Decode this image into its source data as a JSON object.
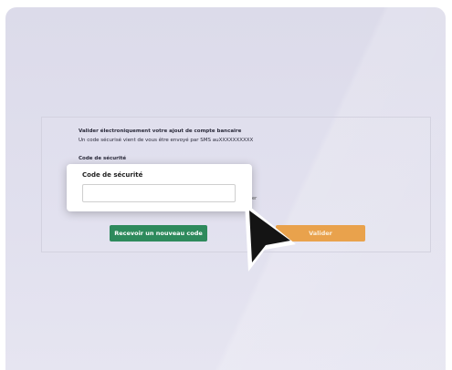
{
  "form": {
    "title": "Valider électroniquement votre ajout de compte bancaire",
    "subtitle": "Un code sécurisé vient de vous être envoyé par SMS auXXXXXXXXXX",
    "code_label": "Code de sécurité",
    "hidden_fragment": "er"
  },
  "popup": {
    "label": "Code de sécurité",
    "input_value": "",
    "input_placeholder": ""
  },
  "buttons": {
    "resend_label": "Recevoir un nouveau code",
    "validate_label": "Valider"
  },
  "colors": {
    "resend_bg": "#2e8a5c",
    "validate_bg": "#e9a24c",
    "page_bg": "#dcdbea"
  },
  "cursor_icon": "arrow-pointer-icon"
}
